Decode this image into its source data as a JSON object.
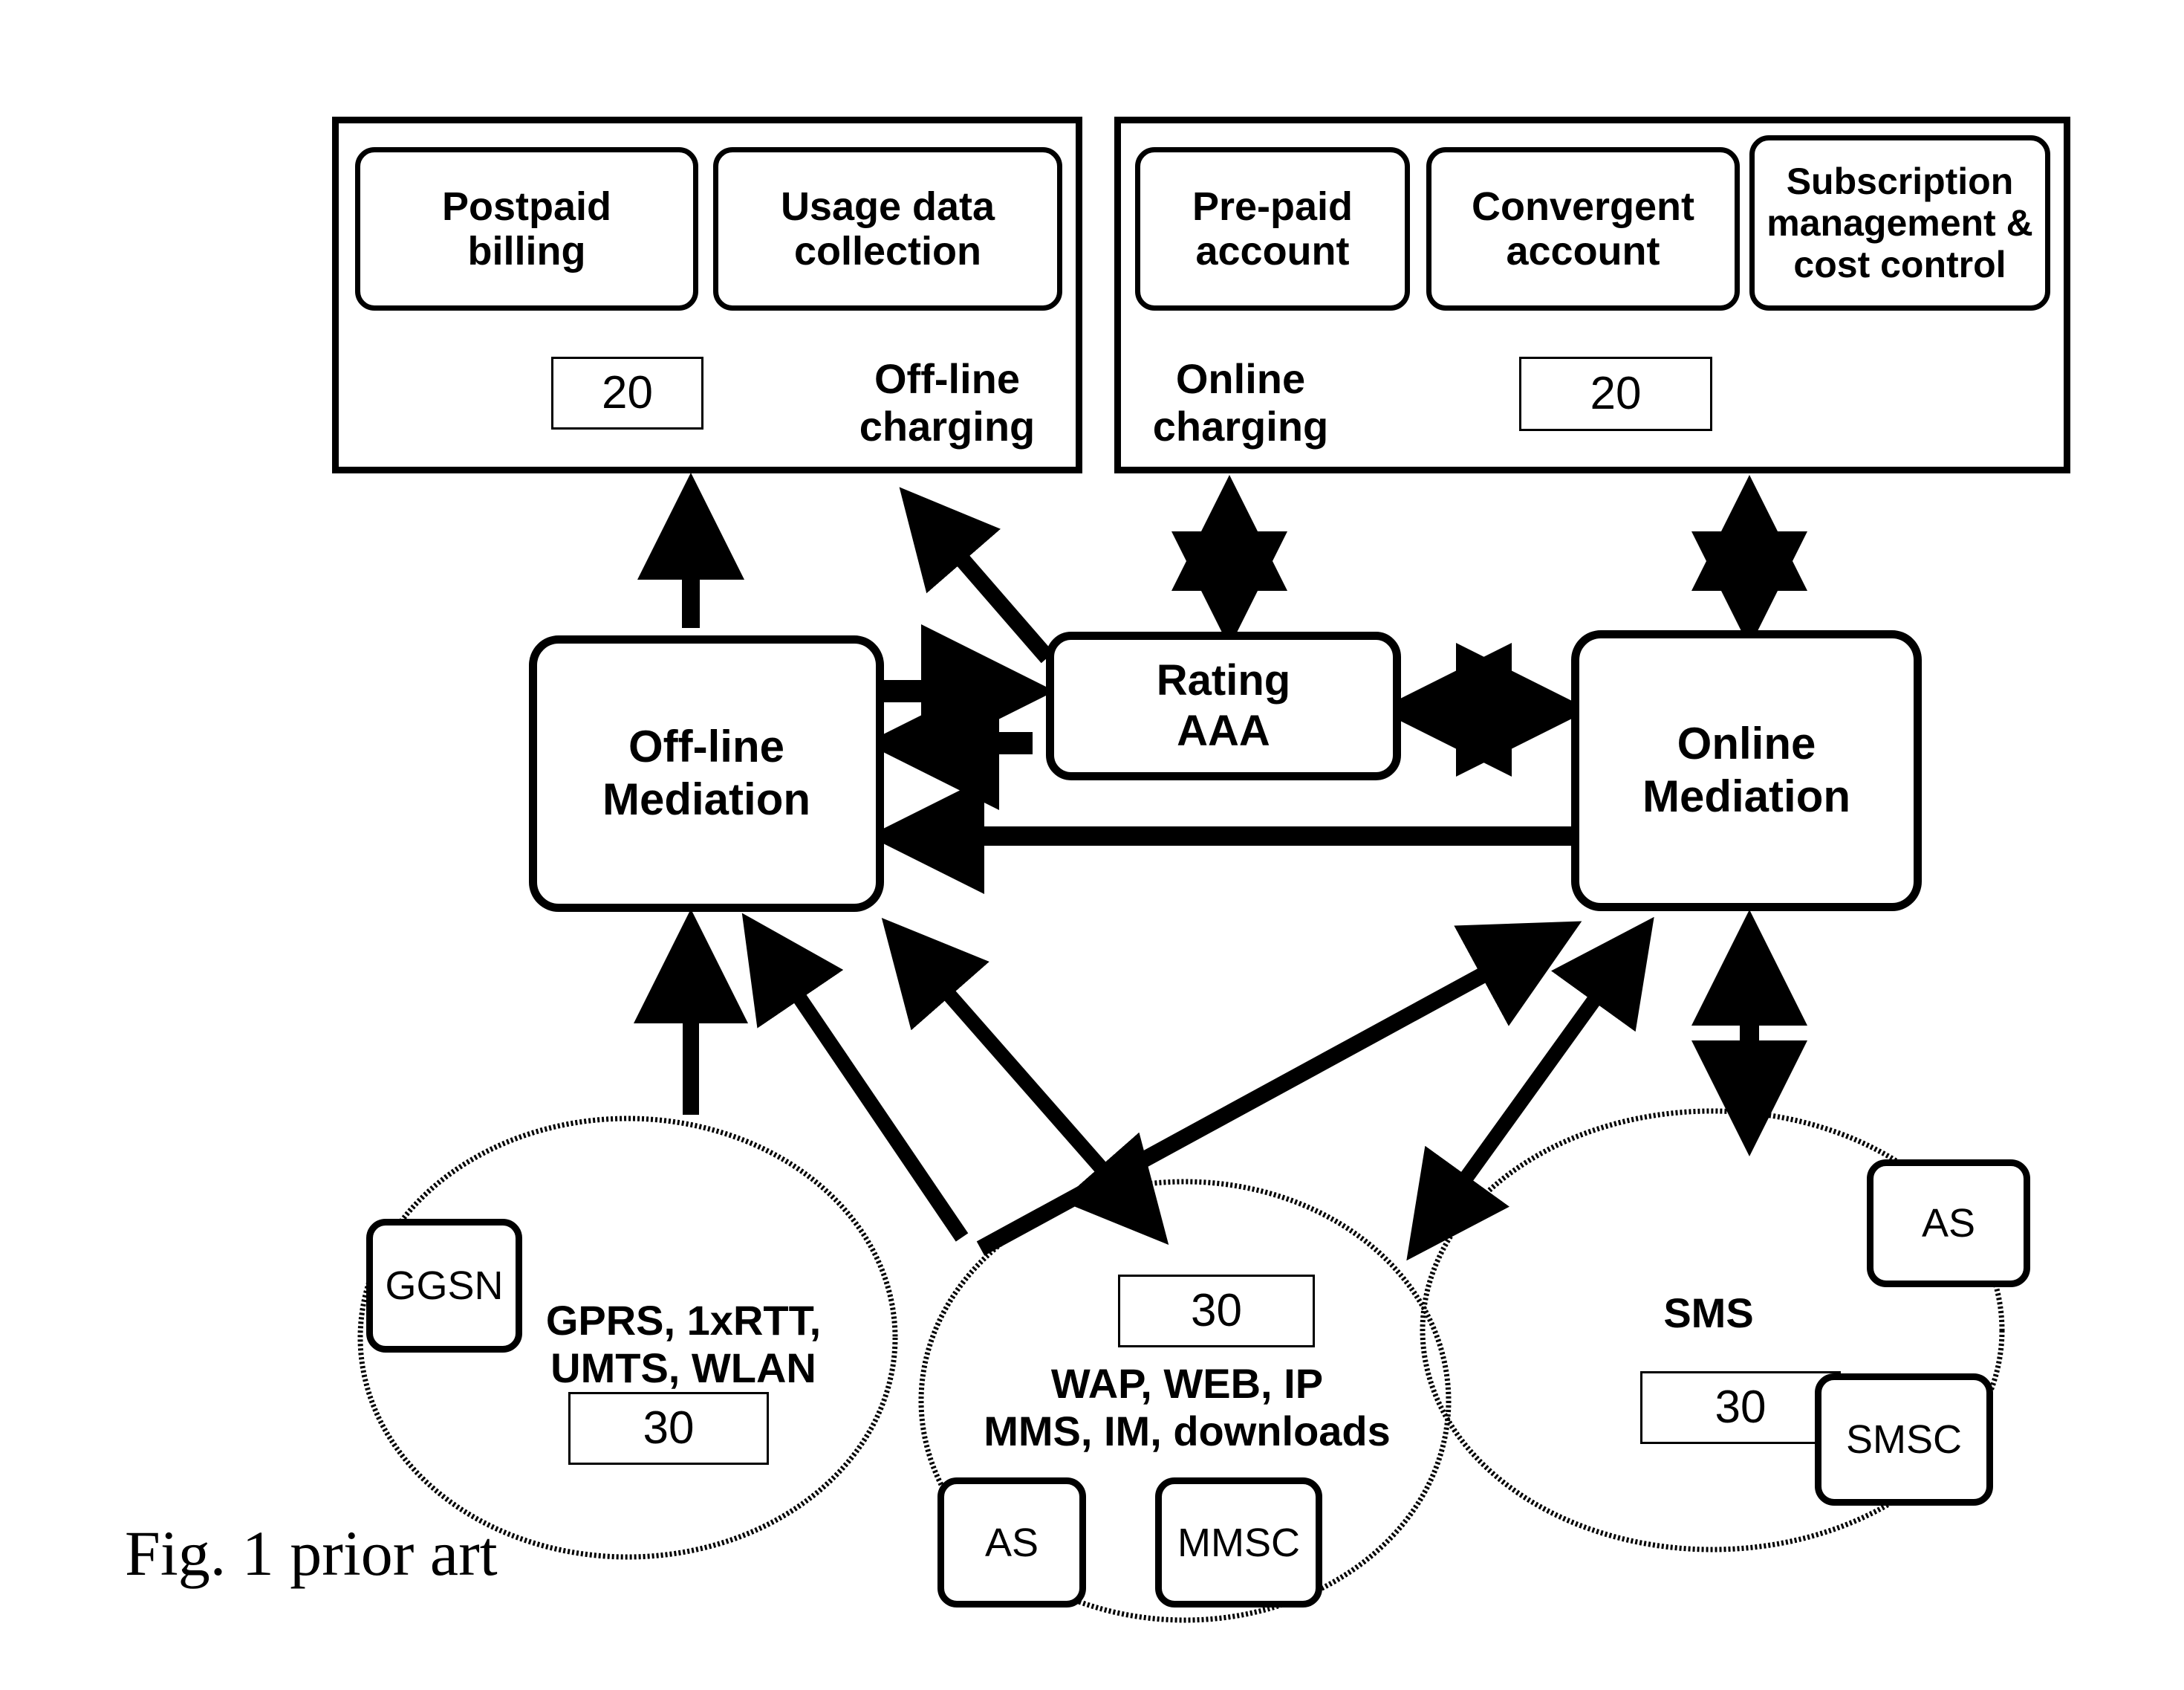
{
  "figure": {
    "caption": "Fig. 1 prior art"
  },
  "offline_domain": {
    "label": "Off-line\ncharging",
    "ref_numeral": "20",
    "capabilities": [
      {
        "label": "Postpaid\nbilling"
      },
      {
        "label": "Usage data\ncollection"
      }
    ]
  },
  "online_domain": {
    "label": "Online\ncharging",
    "ref_numeral": "20",
    "capabilities": [
      {
        "label": "Pre-paid\naccount"
      },
      {
        "label": "Convergent\naccount"
      },
      {
        "label": "Subscription\nmanagement &\ncost control"
      }
    ]
  },
  "mediation": {
    "offline": {
      "label": "Off-line\nMediation"
    },
    "rating": {
      "label": "Rating\nAAA"
    },
    "online": {
      "label": "Online\nMediation"
    }
  },
  "networks": [
    {
      "id": "packet-data",
      "label": "GPRS, 1xRTT,\nUMTS, WLAN",
      "ref_numeral": "30",
      "elements": [
        {
          "label": "GGSN"
        }
      ]
    },
    {
      "id": "content-services",
      "label": "WAP, WEB, IP\nMMS, IM, downloads",
      "ref_numeral": "30",
      "elements": [
        {
          "label": "AS"
        },
        {
          "label": "MMSC"
        }
      ]
    },
    {
      "id": "messaging",
      "label": "SMS",
      "ref_numeral": "30",
      "elements": [
        {
          "label": "AS"
        },
        {
          "label": "SMSC"
        }
      ]
    }
  ],
  "colors": {
    "stroke": "#000000",
    "fill": "#ffffff"
  }
}
